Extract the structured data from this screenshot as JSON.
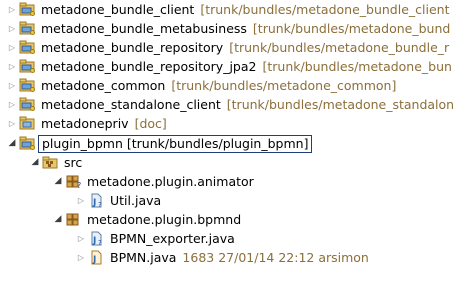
{
  "tree": {
    "projects": [
      {
        "name": "metadone_bundle_client",
        "decoration": "[trunk/bundles/metadone_bundle_client"
      },
      {
        "name": "metadone_bundle_metabusiness",
        "decoration": "[trunk/bundles/metadone_bund"
      },
      {
        "name": "metadone_bundle_repository",
        "decoration": "[trunk/bundles/metadone_bundle_r"
      },
      {
        "name": "metadone_bundle_repository_jpa2",
        "decoration": "[trunk/bundles/metadone_bun"
      },
      {
        "name": "metadone_common",
        "decoration": "[trunk/bundles/metadone_common]"
      },
      {
        "name": "metadone_standalone_client",
        "decoration": "[trunk/bundles/metadone_standalon"
      },
      {
        "name": "metadonepriv",
        "decoration": "[doc]"
      }
    ],
    "selected_project": {
      "name": "plugin_bpmn",
      "decoration": "[trunk/bundles/plugin_bpmn]"
    },
    "src_folder": "src",
    "packages": [
      {
        "name": "metadone.plugin.animator",
        "files": [
          {
            "name": "Util.java",
            "decoration": ""
          }
        ]
      },
      {
        "name": "metadone.plugin.bpmnd",
        "files": [
          {
            "name": "BPMN_exporter.java",
            "decoration": ""
          },
          {
            "name": "BPMN.java",
            "decoration": "1683  27/01/14 22:12  arsimon"
          }
        ]
      }
    ]
  },
  "colors": {
    "decoration": "#8c6f3a",
    "selection_border": "#1f3f78",
    "twisty": "#7f8b98"
  },
  "icons": {
    "project": "java-project-icon",
    "src": "source-folder-icon",
    "package": "package-icon",
    "file": "java-file-icon"
  }
}
